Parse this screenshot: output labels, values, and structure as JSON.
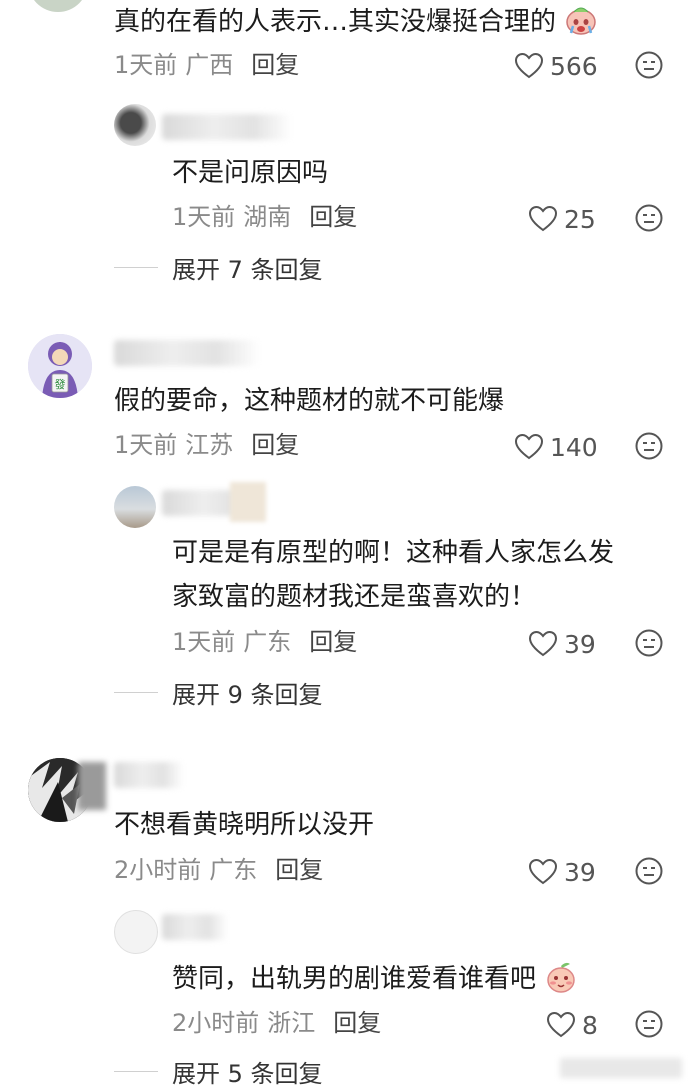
{
  "comments": [
    {
      "text": "真的在看的人表示…其实没爆挺合理的",
      "time": "1天前",
      "location": "广西",
      "reply_label": "回复",
      "likes": "566",
      "reply": {
        "text": "不是问原因吗",
        "time": "1天前",
        "location": "湖南",
        "reply_label": "回复",
        "likes": "25"
      },
      "expand": "展开 7 条回复"
    },
    {
      "text": "假的要命，这种题材的就不可能爆",
      "time": "1天前",
      "location": "江苏",
      "reply_label": "回复",
      "likes": "140",
      "reply": {
        "text_line1": "可是是有原型的啊！这种看人家怎么发",
        "text_line2": "家致富的题材我还是蛮喜欢的！",
        "time": "1天前",
        "location": "广东",
        "reply_label": "回复",
        "likes": "39"
      },
      "expand": "展开 9 条回复"
    },
    {
      "text": "不想看黄晓明所以没开",
      "time": "2小时前",
      "location": "广东",
      "reply_label": "回复",
      "likes": "39",
      "reply": {
        "text": "赞同，出轨男的剧谁爱看谁看吧",
        "time": "2小时前",
        "location": "浙江",
        "reply_label": "回复",
        "likes": "8"
      },
      "expand": "展开 5 条回复"
    }
  ],
  "icons": {
    "like": "heart-outline-icon",
    "emoji": "emoji-face-icon"
  },
  "colors": {
    "text": "#1c1c1c",
    "meta": "#8a8a8a",
    "reply": "#444444"
  }
}
